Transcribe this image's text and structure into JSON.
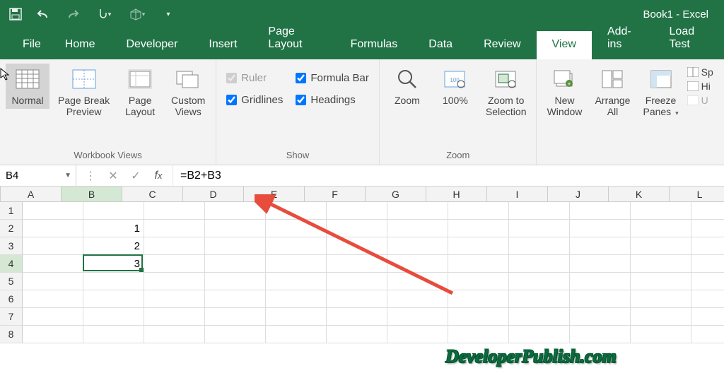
{
  "title": "Book1 - Excel",
  "qat": {
    "save": "save-icon",
    "undo": "undo-icon",
    "redo": "redo-icon",
    "touch": "touch-icon",
    "x3d": "3d-icon",
    "more": "▾"
  },
  "tabs": [
    "File",
    "Home",
    "Developer",
    "Insert",
    "Page Layout",
    "Formulas",
    "Data",
    "Review",
    "View",
    "Add-ins",
    "Load Test"
  ],
  "active_tab": "View",
  "ribbon": {
    "workbook_views": {
      "label": "Workbook Views",
      "normal": "Normal",
      "page_break": "Page Break\nPreview",
      "page_layout": "Page\nLayout",
      "custom": "Custom\nViews"
    },
    "show": {
      "label": "Show",
      "ruler": "Ruler",
      "gridlines": "Gridlines",
      "formula_bar": "Formula Bar",
      "headings": "Headings"
    },
    "zoom": {
      "label": "Zoom",
      "zoom": "Zoom",
      "hundred": "100%",
      "selection": "Zoom to\nSelection"
    },
    "window": {
      "new_window": "New\nWindow",
      "arrange": "Arrange\nAll",
      "freeze": "Freeze\nPanes",
      "split": "Sp",
      "hide": "Hi",
      "unhide": "U"
    }
  },
  "namebox": "B4",
  "formula": "=B2+B3",
  "columns": [
    "A",
    "B",
    "C",
    "D",
    "E",
    "F",
    "G",
    "H",
    "I",
    "J",
    "K",
    "L"
  ],
  "rows": [
    "1",
    "2",
    "3",
    "4",
    "5",
    "6",
    "7",
    "8"
  ],
  "cell_data": {
    "B2": "1",
    "B3": "2",
    "B4": "3"
  },
  "active_cell": {
    "col": 1,
    "row": 3
  },
  "watermark": "DeveloperPublish.com"
}
